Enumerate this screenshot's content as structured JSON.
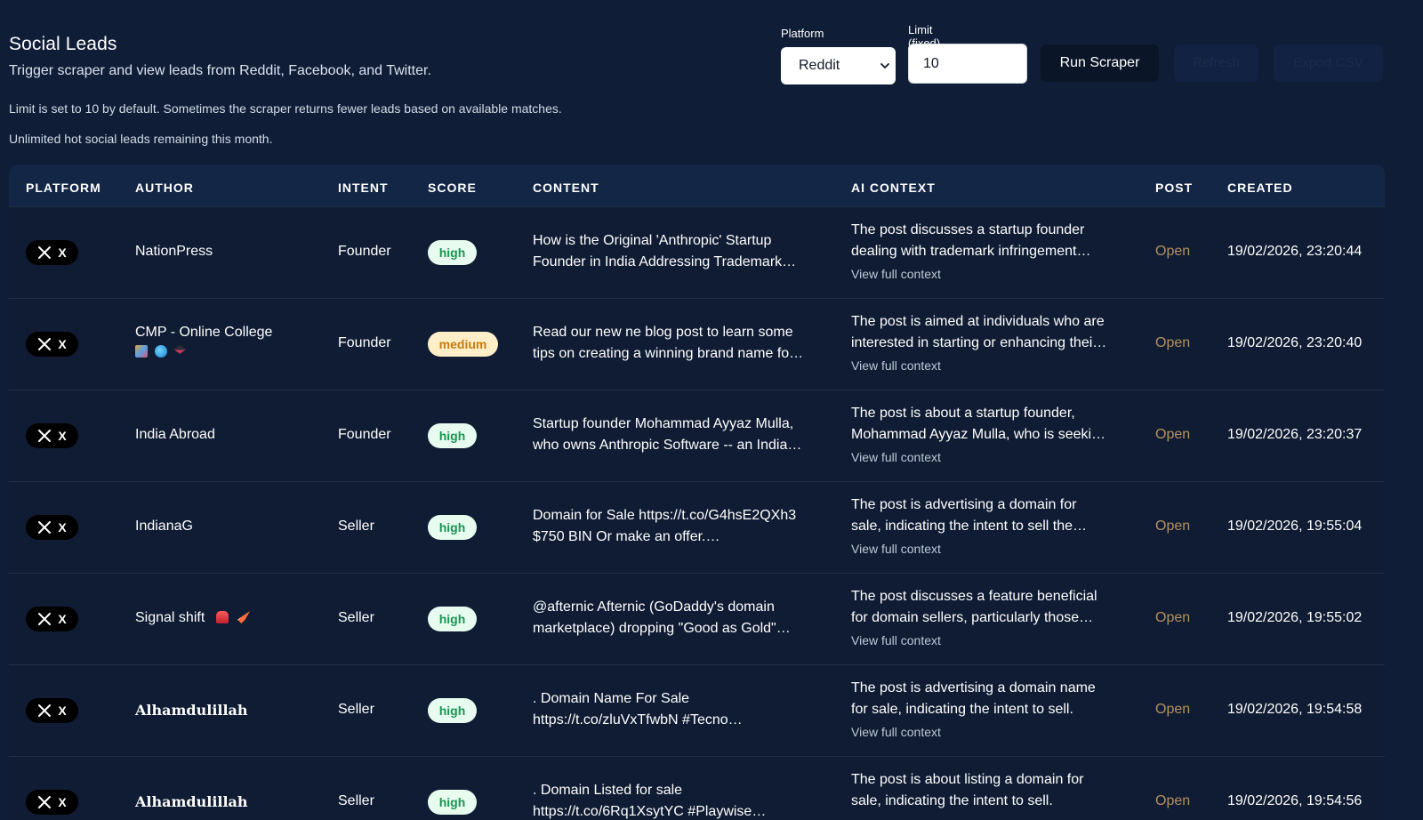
{
  "header": {
    "title": "Social Leads",
    "subtitle": "Trigger scraper and view leads from Reddit, Facebook, and Twitter.",
    "note_limit": "Limit is set to 10 by default. Sometimes the scraper returns fewer leads based on available matches.",
    "note_remaining": "Unlimited hot social leads remaining this month."
  },
  "controls": {
    "platform_label": "Platform",
    "platform_value": "Reddit",
    "limit_label": "Limit (fixed)",
    "limit_value": "10",
    "run_label": "Run Scraper",
    "refresh_label": "Refresh",
    "export_label": "Export CSV"
  },
  "table": {
    "columns": [
      "PLATFORM",
      "AUTHOR",
      "INTENT",
      "SCORE",
      "CONTENT",
      "AI CONTEXT",
      "POST",
      "CREATED"
    ],
    "rows": [
      {
        "platform": "X",
        "author": "NationPress",
        "author_sub": "",
        "intent": "Founder",
        "score": "high",
        "content_1": "How is the Original 'Anthropic' Startup",
        "content_2": "Founder in India Addressing Trademark…",
        "ai_1": "The post discusses a startup founder",
        "ai_2": "dealing with trademark infringement…",
        "ai_link": "View full context",
        "post": "Open",
        "created": "19/02/2026, 23:20:44"
      },
      {
        "platform": "X",
        "author": "CMP - Online College",
        "author_sub": "📚🌏🎓",
        "intent": "Founder",
        "score": "medium",
        "content_1": "Read our new ne blog post to learn some",
        "content_2": "tips on creating a winning brand name fo…",
        "ai_1": "The post is aimed at individuals who are",
        "ai_2": "interested in starting or enhancing thei…",
        "ai_link": "View full context",
        "post": "Open",
        "created": "19/02/2026, 23:20:40"
      },
      {
        "platform": "X",
        "author": "India Abroad",
        "author_sub": "",
        "intent": "Founder",
        "score": "high",
        "content_1": "Startup founder Mohammad Ayyaz Mulla,",
        "content_2": "who owns Anthropic Software -- an India…",
        "ai_1": "The post is about a startup founder,",
        "ai_2": "Mohammad Ayyaz Mulla, who is seeki…",
        "ai_link": "View full context",
        "post": "Open",
        "created": "19/02/2026, 23:20:37"
      },
      {
        "platform": "X",
        "author": "IndianaG",
        "author_sub": "",
        "intent": "Seller",
        "score": "high",
        "content_1": "Domain for Sale https://t.co/G4hsE2QXh3",
        "content_2": "$750 BIN Or make an offer.…",
        "ai_1": "The post is advertising a domain for",
        "ai_2": "sale, indicating the intent to sell the…",
        "ai_link": "View full context",
        "post": "Open",
        "created": "19/02/2026, 19:55:04"
      },
      {
        "platform": "X",
        "author": "Signal shift",
        "author_sub": "🚨🚀",
        "intent": "Seller",
        "score": "high",
        "content_1": "@afternic Afternic (GoDaddy's domain",
        "content_2": "marketplace) dropping \"Good as Gold\"…",
        "ai_1": "The post discusses a feature beneficial",
        "ai_2": "for domain sellers, particularly those…",
        "ai_link": "View full context",
        "post": "Open",
        "created": "19/02/2026, 19:55:02"
      },
      {
        "platform": "X",
        "author": "Alhamdulillah",
        "author_sub": "",
        "intent": "Seller",
        "score": "high",
        "content_1": ". Domain Name For Sale",
        "content_2": "https://t.co/zluVxTfwbN #Tecno…",
        "ai_1": "The post is advertising a domain name",
        "ai_2": "for sale, indicating the intent to sell.",
        "ai_link": "View full context",
        "post": "Open",
        "created": "19/02/2026, 19:54:58"
      },
      {
        "platform": "X",
        "author": "Alhamdulillah",
        "author_sub": "",
        "intent": "Seller",
        "score": "high",
        "content_1": ". Domain Listed for sale",
        "content_2": "https://t.co/6Rq1XsytYC #Playwise…",
        "ai_1": "The post is about listing a domain for",
        "ai_2": "sale, indicating the intent to sell.",
        "ai_link": "",
        "post": "Open",
        "created": "19/02/2026, 19:54:56"
      }
    ]
  }
}
